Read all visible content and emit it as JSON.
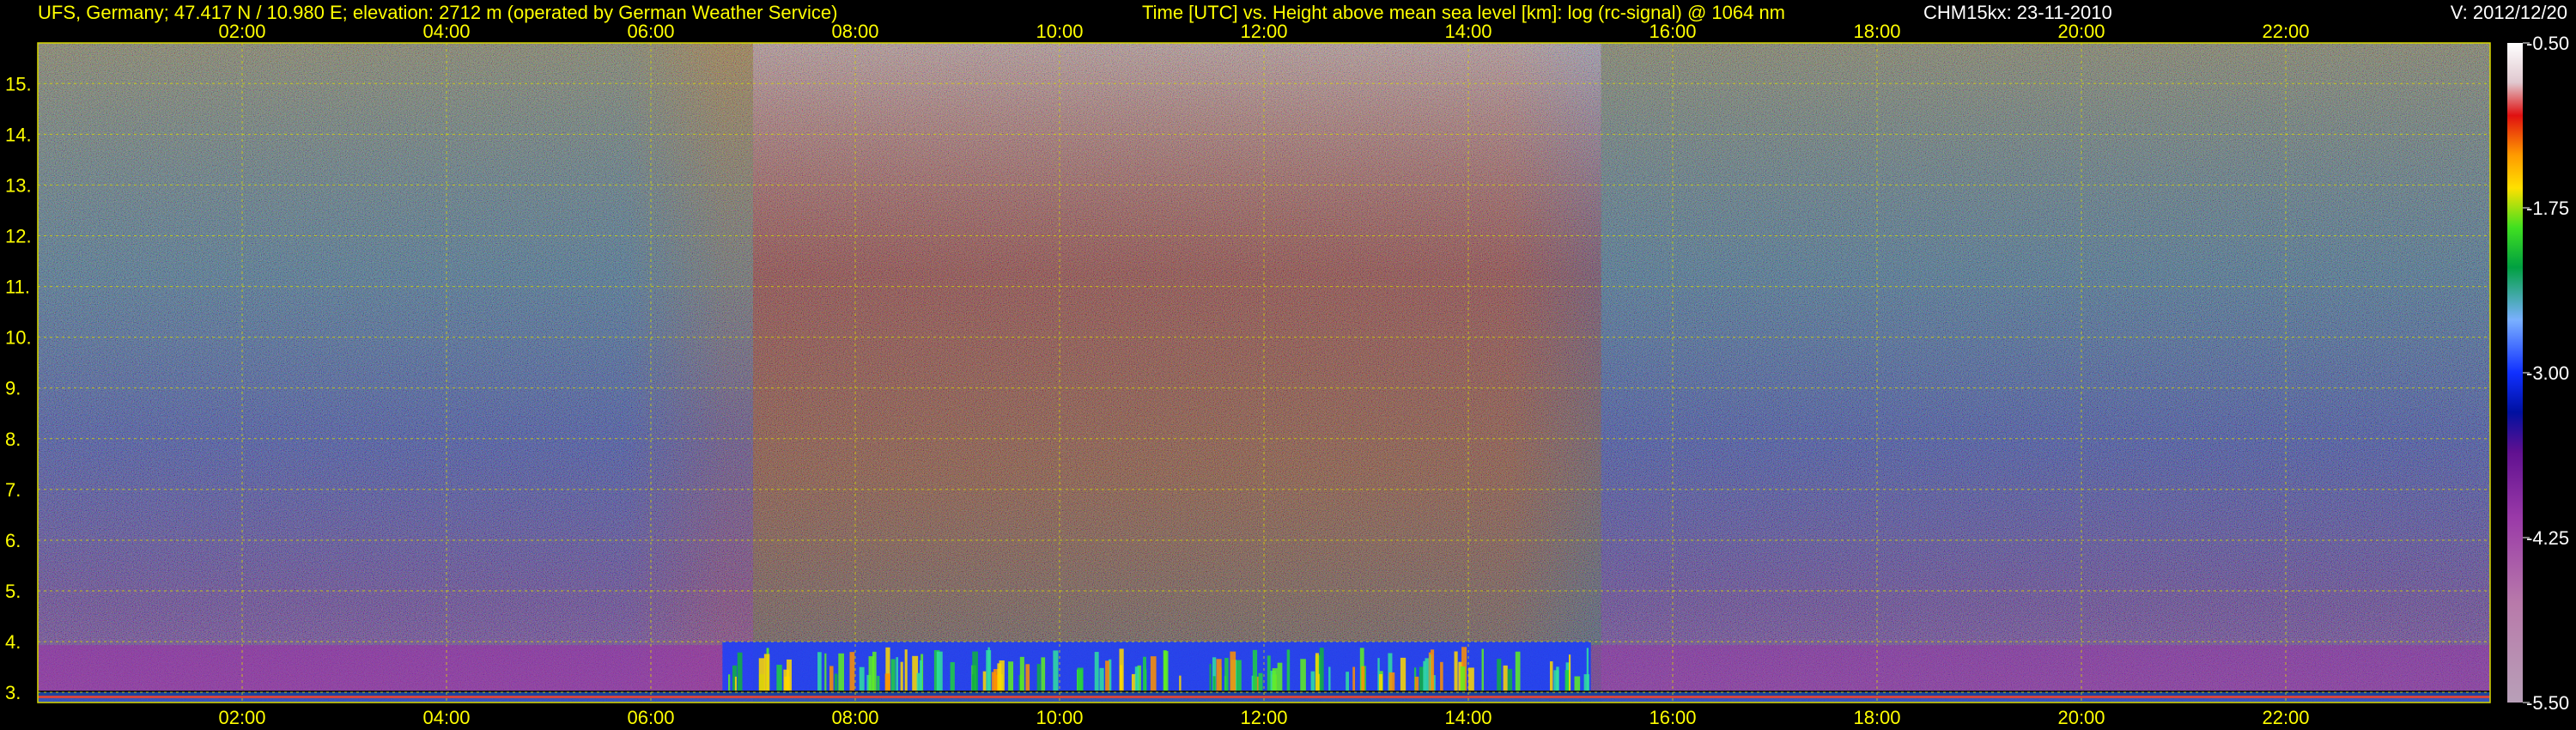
{
  "header": {
    "station": "UFS, Germany; 47.417 N / 10.980 E; elevation: 2712 m  (operated by German Weather Service)",
    "axes_title": "Time [UTC] vs. Height above mean sea level [km]: log (rc-signal) @ 1064 nm",
    "instrument_date": "CHM15kx: 23-11-2010",
    "version": "V: 2012/12/20"
  },
  "colors": {
    "background": "#000000",
    "label_text": "#ffff00",
    "header_text_right": "#ffffff",
    "grid": "#d8d800"
  },
  "chart_data": {
    "type": "heatmap",
    "title": "Time [UTC] vs. Height above mean sea level [km]: log (rc-signal) @ 1064 nm",
    "x_ticks": [
      "02:00",
      "04:00",
      "06:00",
      "08:00",
      "10:00",
      "12:00",
      "14:00",
      "16:00",
      "18:00",
      "20:00",
      "22:00"
    ],
    "x_tick_hours": [
      2,
      4,
      6,
      8,
      10,
      12,
      14,
      16,
      18,
      20,
      22
    ],
    "xlim_hours": [
      0,
      24
    ],
    "y_ticks": [
      "3.",
      "4.",
      "5.",
      "6.",
      "7.",
      "8.",
      "9.",
      "10.",
      "11.",
      "12.",
      "13.",
      "14.",
      "15."
    ],
    "y_tick_values": [
      3,
      4,
      5,
      6,
      7,
      8,
      9,
      10,
      11,
      12,
      13,
      14,
      15
    ],
    "ylim_km": [
      2.8,
      15.8
    ],
    "grid": true,
    "colorbar": {
      "range": [
        -5.5,
        -0.5
      ],
      "tick_labels": [
        "-0.50",
        "-1.75",
        "-3.00",
        "-4.25",
        "-5.50"
      ],
      "tick_values": [
        -0.5,
        -1.75,
        -3.0,
        -4.25,
        -5.5
      ]
    },
    "features": {
      "daylight_background_hours": [
        7,
        15.3
      ],
      "boundary_layer_aerosol_hours": [
        6.7,
        15.2
      ],
      "boundary_layer_top_km": 4.0,
      "surface_km": 3.0
    }
  }
}
